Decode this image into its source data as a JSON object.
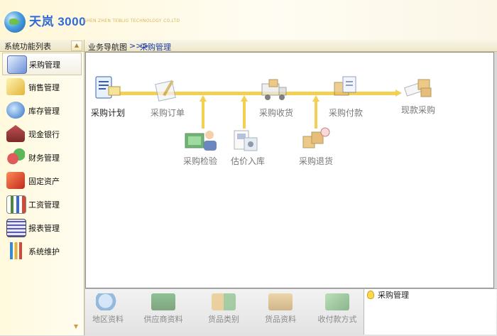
{
  "header": {
    "title": "天岚 3000",
    "subtitle": "SHEN ZHEN TEBLIG TECHNOLOGY CO.LTD"
  },
  "sidebar": {
    "title": "系统功能列表",
    "items": [
      {
        "label": "采购管理",
        "icon": "purchase-icon",
        "active": true
      },
      {
        "label": "销售管理",
        "icon": "folder-icon"
      },
      {
        "label": "库存管理",
        "icon": "inventory-icon"
      },
      {
        "label": "现金银行",
        "icon": "bank-icon"
      },
      {
        "label": "财务管理",
        "icon": "finance-icon"
      },
      {
        "label": "固定资产",
        "icon": "asset-icon"
      },
      {
        "label": "工资管理",
        "icon": "salary-icon"
      },
      {
        "label": "报表管理",
        "icon": "report-icon"
      },
      {
        "label": "系统维护",
        "icon": "maintenance-icon"
      }
    ]
  },
  "breadcrumb": {
    "root": "业务导航图",
    "separator": ">>>",
    "current": "采购管理"
  },
  "flow": {
    "nodes": [
      {
        "id": "plan",
        "label": "采购计划",
        "icon": "purchase-plan-icon"
      },
      {
        "id": "order",
        "label": "采购订单",
        "icon": "purchase-order-icon"
      },
      {
        "id": "receive",
        "label": "采购收货",
        "icon": "purchase-receive-icon"
      },
      {
        "id": "pay",
        "label": "采购付款",
        "icon": "purchase-payment-icon"
      },
      {
        "id": "cash",
        "label": "现款采购",
        "icon": "cash-purchase-icon"
      },
      {
        "id": "inspect",
        "label": "采购检验",
        "icon": "purchase-inspection-icon"
      },
      {
        "id": "estimate",
        "label": "估价入库",
        "icon": "estimate-stockin-icon"
      },
      {
        "id": "return",
        "label": "采购退货",
        "icon": "purchase-return-icon"
      }
    ]
  },
  "shortcuts": [
    {
      "label": "地区资料",
      "icon": "region-icon"
    },
    {
      "label": "供应商资料",
      "icon": "supplier-icon"
    },
    {
      "label": "货品类别",
      "icon": "goods-category-icon"
    },
    {
      "label": "货品资料",
      "icon": "goods-icon"
    },
    {
      "label": "收付款方式",
      "icon": "payment-method-icon"
    }
  ],
  "status": {
    "text": "采购管理"
  },
  "colors": {
    "flow_line": "#f3cf52",
    "breadcrumb_link": "#1a3aa8",
    "title_blue": "#2f6bd6"
  }
}
